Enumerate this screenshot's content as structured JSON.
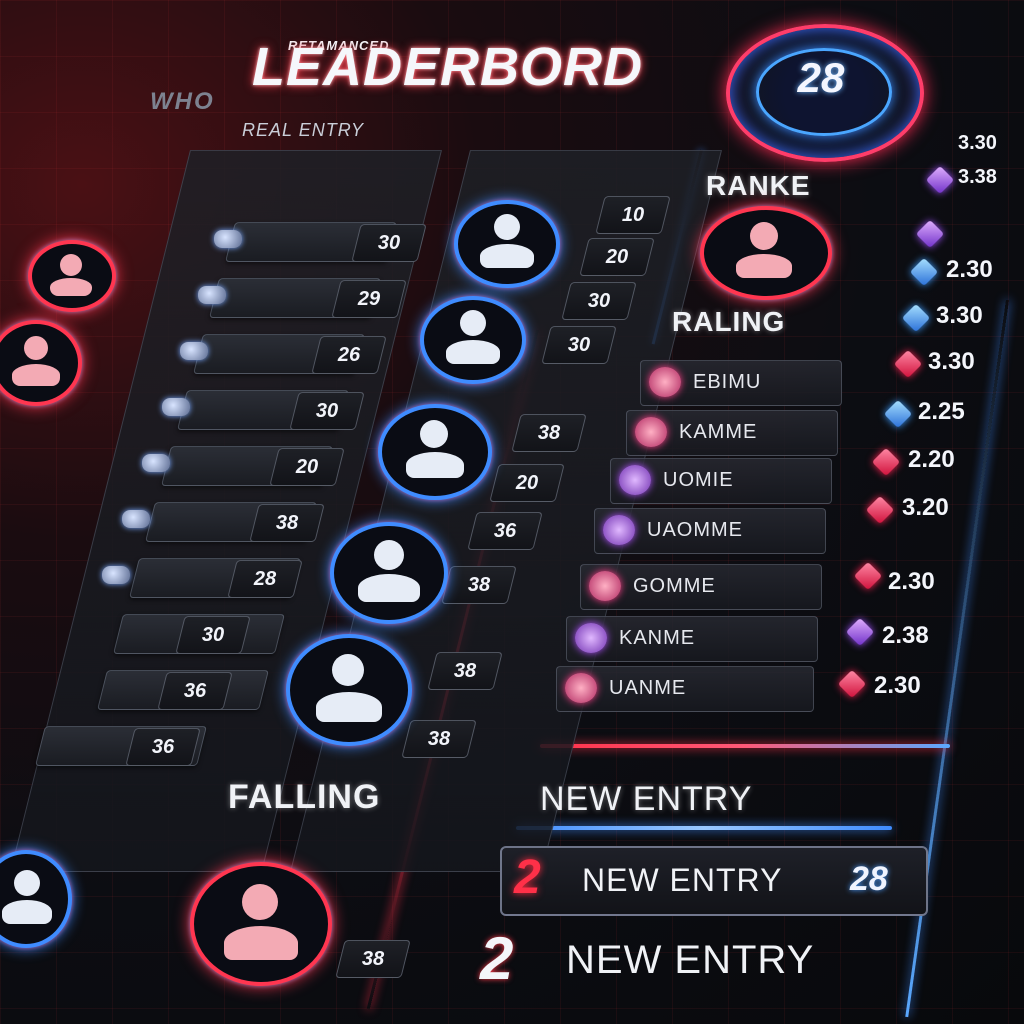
{
  "header": {
    "title_small": "RETAMANCED",
    "title": "LEADERBORD",
    "subtitle": "REAL ENTRY",
    "side_logo": "WHO"
  },
  "rank_badge": {
    "value": "28"
  },
  "labels": {
    "ranked": "RANKE",
    "rising": "RALING",
    "falling": "FALLING",
    "new_entry_heading": "NEW ENTRY"
  },
  "left_column": {
    "numbers": [
      "30",
      "29",
      "26",
      "30",
      "20",
      "38",
      "28",
      "30",
      "36",
      "36"
    ]
  },
  "mid_column": {
    "numbers": [
      "10",
      "20",
      "30",
      "30",
      "38",
      "20",
      "36",
      "38",
      "38",
      "38"
    ]
  },
  "right_list": {
    "names": [
      "EBIMU",
      "KAMME",
      "UOMIE",
      "UAOMME",
      "GOMME",
      "KANME",
      "UANME"
    ],
    "scores": [
      "3.30",
      "3.38",
      "2.30",
      "3.30",
      "3.30",
      "2.25",
      "2.20",
      "3.20",
      "2.30",
      "2.38",
      "2.30"
    ]
  },
  "new_entries": [
    {
      "rank": "2",
      "text": "NEW ENTRY",
      "score": "28"
    },
    {
      "rank": "2",
      "text": "NEW ENTRY"
    }
  ],
  "colors": {
    "accent_red": "#ff3048",
    "accent_blue": "#3f8cff",
    "background": "#0c0d12"
  }
}
